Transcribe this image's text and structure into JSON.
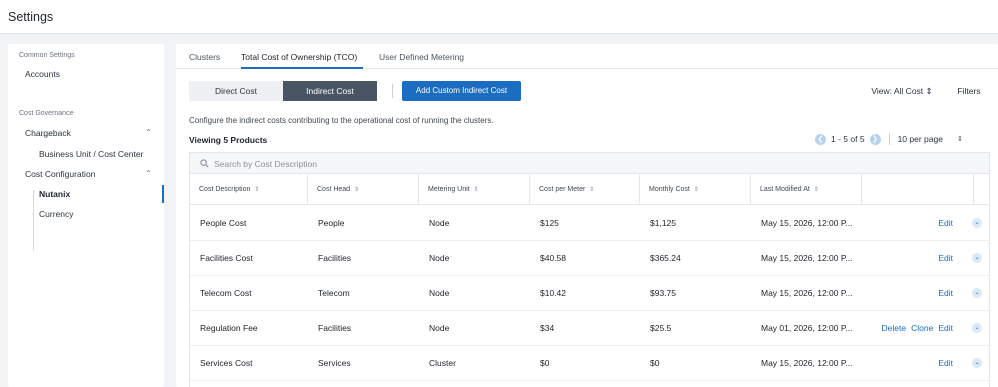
{
  "app": {
    "title": "Settings"
  },
  "sidebar": {
    "sections": [
      {
        "label": "Common Settings"
      },
      {
        "label": "Cost Governance"
      }
    ],
    "items": [
      {
        "label": "Accounts"
      },
      {
        "label": "Chargeback"
      },
      {
        "label": "Business Unit / Cost Center"
      },
      {
        "label": "Cost Configuration"
      },
      {
        "label": "Nutanix"
      },
      {
        "label": "Currency"
      }
    ],
    "active_item": "Nutanix"
  },
  "tabs": [
    {
      "label": "Clusters"
    },
    {
      "label": "Total Cost of Ownership (TCO)"
    },
    {
      "label": "User Defined Metering"
    }
  ],
  "active_tab": "Total Cost of Ownership (TCO)",
  "toolbar": {
    "direct_cost": "Direct Cost",
    "indirect_cost": "Indirect Cost",
    "add_custom": "Add Custom Indirect Cost",
    "view_label": "View: All Cost ⇕",
    "filters": "Filters"
  },
  "description": "Configure the indirect costs contributing to the operational cost of running the clusters.",
  "viewing": "Viewing 5 Products",
  "pagination": {
    "range": "1 - 5 of 5",
    "per_page": "10 per page"
  },
  "search": {
    "placeholder": "Search by Cost Description"
  },
  "table": {
    "columns": [
      "Cost Description",
      "Cost Head",
      "Metering Unit",
      "Cost per Meter",
      "Monthly Cost",
      "Last Modified At"
    ],
    "rows": [
      {
        "description": "People Cost",
        "head": "People",
        "unit": "Node",
        "per_meter": "$125",
        "monthly": "$1,125",
        "modified": "May 15, 2026, 12:00 P...",
        "actions": [
          "Edit"
        ]
      },
      {
        "description": "Facilities Cost",
        "head": "Facilities",
        "unit": "Node",
        "per_meter": "$40.58",
        "monthly": "$365.24",
        "modified": "May 15, 2026, 12:00 P...",
        "actions": [
          "Edit"
        ]
      },
      {
        "description": "Telecom Cost",
        "head": "Telecom",
        "unit": "Node",
        "per_meter": "$10.42",
        "monthly": "$93.75",
        "modified": "May 15, 2026, 12:00 P...",
        "actions": [
          "Edit"
        ]
      },
      {
        "description": "Regulation Fee",
        "head": "Facilities",
        "unit": "Node",
        "per_meter": "$34",
        "monthly": "$25.5",
        "modified": "May 01, 2026, 12:00 P...",
        "actions": [
          "Delete",
          "Clone",
          "Edit"
        ]
      },
      {
        "description": "Services Cost",
        "head": "Services",
        "unit": "Cluster",
        "per_meter": "$0",
        "monthly": "$0",
        "modified": "May 15, 2026, 12:00 P...",
        "actions": [
          "Edit"
        ]
      }
    ]
  },
  "colors": {
    "accent": "#1b6dc1",
    "segment_active": "#4a5564",
    "background": "#f2f3f5"
  },
  "icons": [
    "search-icon",
    "chevron-up-icon",
    "chevron-left-icon",
    "chevron-right-icon",
    "chevron-down-icon",
    "sort-icon"
  ]
}
